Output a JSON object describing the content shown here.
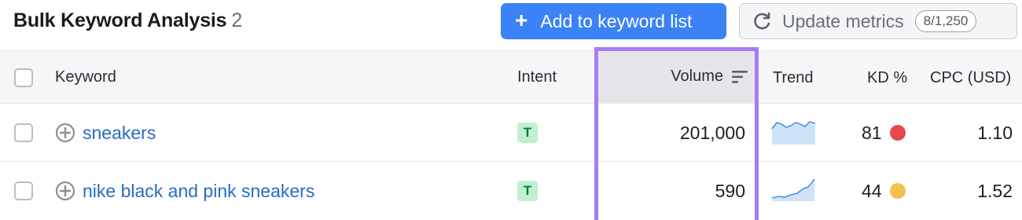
{
  "header": {
    "title": "Bulk Keyword Analysis",
    "count": "2",
    "add_button_label": "Add to keyword list",
    "update_button_label": "Update metrics",
    "update_badge": "8/1,250"
  },
  "columns": {
    "keyword": "Keyword",
    "intent": "Intent",
    "volume": "Volume",
    "trend": "Trend",
    "kd": "KD %",
    "cpc": "CPC (USD)"
  },
  "rows": [
    {
      "keyword": "sneakers",
      "intent": "T",
      "volume": "201,000",
      "kd": "81",
      "kd_color": "#e5484d",
      "cpc": "1.10"
    },
    {
      "keyword": "nike black and pink sneakers",
      "intent": "T",
      "volume": "590",
      "kd": "44",
      "kd_color": "#f2c14e",
      "cpc": "1.52"
    }
  ],
  "colors": {
    "accent": "#3b82f6",
    "highlight_border": "#a97cf0",
    "link": "#2a6bc4",
    "intent_bg": "#bff0cf",
    "intent_text": "#0d7a3c"
  }
}
